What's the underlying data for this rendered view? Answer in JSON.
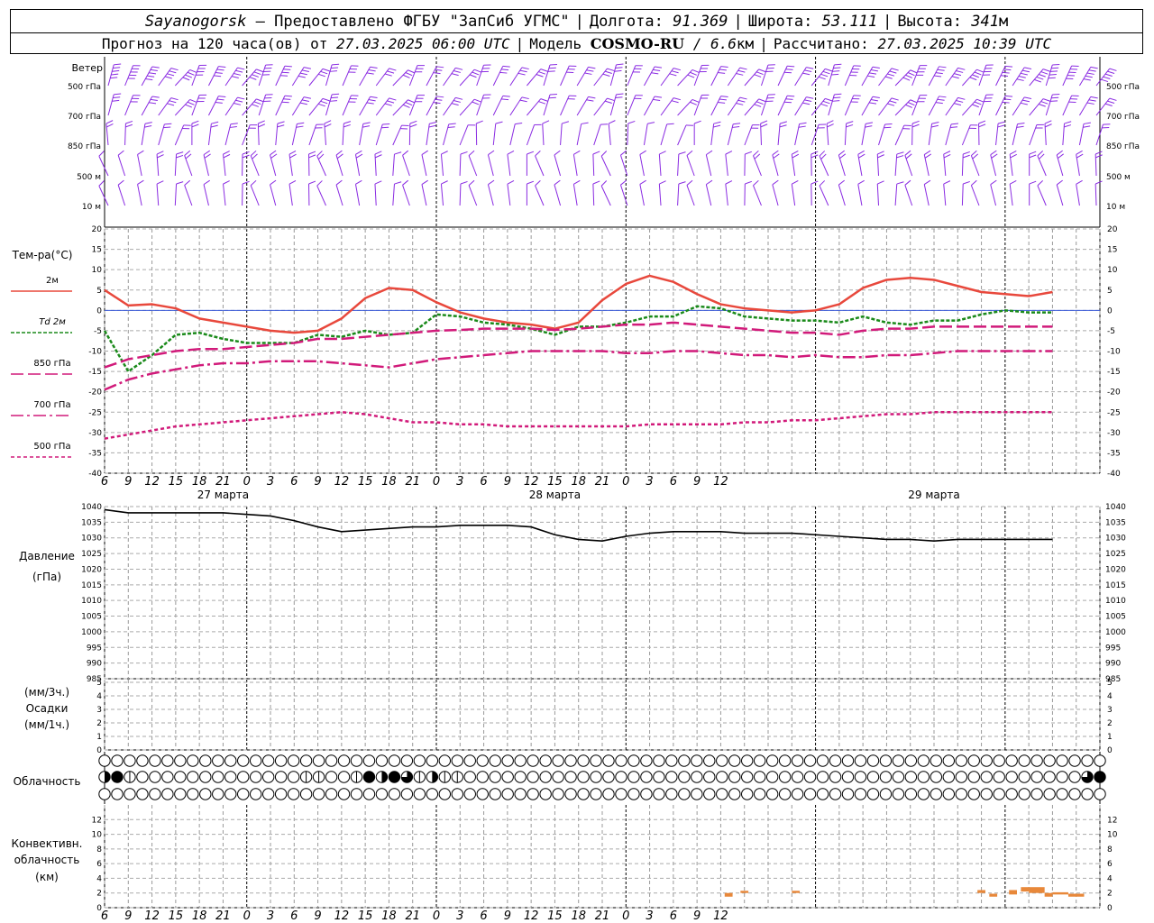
{
  "header": {
    "city": "Sayanogorsk",
    "dash": "—",
    "provider": "Предоставлено ФГБУ \"ЗапСиб УГМС\"",
    "lon_label": "Долгота:",
    "lon_value": "91.369",
    "lat_label": "Широта:",
    "lat_value": "53.111",
    "alt_label": "Высота:",
    "alt_value": "341",
    "alt_unit": "м",
    "forecast_label": "Прогноз на 120 часа(ов) от",
    "forecast_start": "27.03.2025 06:00 UTC",
    "model_label": "Модель",
    "model_name": "COSMO-RU",
    "model_res": "6.6",
    "model_res_unit": "км",
    "calc_label": "Рассчитано:",
    "calc_time": "27.03.2025 10:39 UTC"
  },
  "colors": {
    "t2m": "#e8483c",
    "td": "#1a8a1a",
    "t850": "#d11a7a",
    "t700": "#d11a7a",
    "t500": "#d11a7a",
    "wind": "#8a2be2",
    "pressure": "#000000",
    "convective": "#e8883a",
    "zero_line": "#3a5ad8"
  },
  "wind_panel": {
    "title": "Ветер",
    "levels": [
      "500 гПа",
      "700 гПа",
      "850 гПа",
      "500 м",
      "10  м"
    ]
  },
  "temp_panel": {
    "title": "Тем-ра(°С)",
    "legend": [
      {
        "label": "2м",
        "key": "t2m"
      },
      {
        "label_prefix": "Td",
        "label": "2м",
        "key": "td"
      },
      {
        "label": "850 гПа",
        "key": "t850"
      },
      {
        "label": "700 гПа",
        "key": "t700"
      },
      {
        "label": "500 гПа",
        "key": "t500"
      }
    ]
  },
  "pressure_panel": {
    "label_1": "Давление",
    "label_2": "(гПа)"
  },
  "precip_panel": {
    "label_1": "(мм/3ч.)",
    "label_2": "Осадки",
    "label_3": "(мм/1ч.)"
  },
  "cloud_panel": {
    "label": "Облачность"
  },
  "conv_panel": {
    "label_1": "Конвективн.",
    "label_2": "облачность",
    "label_3": "(км)"
  },
  "chart_data": [
    {
      "type": "line",
      "name": "temperature",
      "x_hours": [
        0,
        3,
        6,
        9,
        12,
        15,
        18,
        21,
        24,
        27,
        30,
        33,
        36,
        39,
        42,
        45,
        48,
        51,
        54,
        57,
        60,
        63,
        66,
        69,
        72,
        75,
        78,
        81,
        84,
        87,
        90,
        93,
        96,
        99,
        102,
        105,
        108,
        111,
        114,
        117,
        120
      ],
      "x_tick_labels": [
        "6",
        "9",
        "12",
        "15",
        "18",
        "21",
        "0",
        "3",
        "6",
        "9",
        "12",
        "15",
        "18",
        "21",
        "0",
        "3",
        "6",
        "9",
        "12",
        "15",
        "18",
        "21",
        "0",
        "3",
        "6",
        "9",
        "12"
      ],
      "x_day_labels": [
        "27 марта",
        "28 марта",
        "29 марта"
      ],
      "ylim": [
        -40,
        20
      ],
      "yticks": [
        20,
        15,
        10,
        5,
        0,
        -5,
        -10,
        -15,
        -20,
        -25,
        -30,
        -35,
        -40
      ],
      "series": [
        {
          "key": "t2m",
          "values": [
            5,
            1.2,
            1.5,
            0.5,
            -2,
            -3,
            -4,
            -5,
            -5.5,
            -5,
            -2,
            3,
            5.5,
            5,
            2,
            -0.5,
            -2,
            -3,
            -3.5,
            -4.5,
            -3,
            2.5,
            6.5,
            8.5,
            7,
            4,
            1.5,
            0.5,
            0,
            -0.5,
            0,
            1.5,
            5.5,
            7.5,
            8,
            7.5,
            6,
            4.5,
            4,
            3.5,
            4.5
          ]
        },
        {
          "key": "td",
          "values": [
            -5,
            -15,
            -11,
            -6,
            -5.5,
            -7,
            -8,
            -8,
            -8,
            -6,
            -6.5,
            -5,
            -6,
            -5.5,
            -1,
            -1.5,
            -3,
            -3.5,
            -4.5,
            -6,
            -4,
            -4,
            -3,
            -1.5,
            -1.5,
            1,
            0.5,
            -1.5,
            -2,
            -2.5,
            -2.5,
            -3,
            -1.5,
            -3,
            -3.5,
            -2.5,
            -2.5,
            -1,
            0,
            -0.5,
            -0.5
          ]
        },
        {
          "key": "t850",
          "values": [
            -14,
            -12,
            -11,
            -10,
            -9.5,
            -9.5,
            -9,
            -8.5,
            -8,
            -7,
            -7,
            -6.5,
            -6,
            -5.5,
            -5,
            -4.8,
            -4.5,
            -4.5,
            -4.5,
            -4.8,
            -4.5,
            -4,
            -3.5,
            -3.5,
            -3,
            -3.5,
            -4,
            -4.5,
            -5,
            -5.5,
            -5.5,
            -6,
            -5,
            -4.5,
            -4.5,
            -4,
            -4,
            -4,
            -4,
            -4,
            -4
          ]
        },
        {
          "key": "t700",
          "values": [
            -19.5,
            -17,
            -15.5,
            -14.5,
            -13.5,
            -13,
            -13,
            -12.5,
            -12.5,
            -12.5,
            -13,
            -13.5,
            -14,
            -13,
            -12,
            -11.5,
            -11,
            -10.5,
            -10,
            -10,
            -10,
            -10,
            -10.5,
            -10.5,
            -10,
            -10,
            -10.5,
            -11,
            -11,
            -11.5,
            -11,
            -11.5,
            -11.5,
            -11,
            -11,
            -10.5,
            -10,
            -10,
            -10,
            -10,
            -10
          ]
        },
        {
          "key": "t500",
          "values": [
            -31.5,
            -30.5,
            -29.5,
            -28.5,
            -28,
            -27.5,
            -27,
            -26.5,
            -26,
            -25.5,
            -25,
            -25.5,
            -26.5,
            -27.5,
            -27.5,
            -28,
            -28,
            -28.5,
            -28.5,
            -28.5,
            -28.5,
            -28.5,
            -28.5,
            -28,
            -28,
            -28,
            -28,
            -27.5,
            -27.5,
            -27,
            -27,
            -26.5,
            -26,
            -25.5,
            -25.5,
            -25,
            -25,
            -25,
            -25,
            -25,
            -25
          ]
        }
      ]
    },
    {
      "type": "line",
      "name": "pressure",
      "ylim": [
        985,
        1040
      ],
      "yticks": [
        1040,
        1035,
        1030,
        1025,
        1020,
        1015,
        1010,
        1005,
        1000,
        995,
        990,
        985
      ],
      "x_hours": [
        0,
        3,
        6,
        9,
        12,
        15,
        18,
        21,
        24,
        27,
        30,
        33,
        36,
        39,
        42,
        45,
        48,
        51,
        54,
        57,
        60,
        63,
        66,
        69,
        72,
        75,
        78,
        81,
        84,
        87,
        90,
        93,
        96,
        99,
        102,
        105,
        108,
        111,
        114,
        117,
        120
      ],
      "values": [
        1039,
        1038,
        1038,
        1038,
        1038,
        1038,
        1037.5,
        1037,
        1035.5,
        1033.5,
        1032,
        1032.5,
        1033,
        1033.5,
        1033.5,
        1034,
        1034,
        1034,
        1033.5,
        1031,
        1029.5,
        1029,
        1030.5,
        1031.5,
        1032,
        1032,
        1032,
        1031.5,
        1031.5,
        1031.5,
        1031,
        1030.5,
        1030,
        1029.5,
        1029.5,
        1029,
        1029.5,
        1029.5,
        1029.5,
        1029.5,
        1029.5
      ]
    },
    {
      "type": "bar",
      "name": "precipitation",
      "ylim": [
        0,
        5
      ],
      "yticks": [
        5,
        4,
        3,
        2,
        1,
        0
      ],
      "values": []
    },
    {
      "type": "bar",
      "name": "convective_cloud",
      "ylim": [
        0,
        14
      ],
      "yticks": [
        12,
        10,
        8,
        6,
        4,
        2,
        0
      ],
      "segments": [
        {
          "x0": 78.5,
          "x1": 79.5,
          "y0": 1.5,
          "y1": 2
        },
        {
          "x0": 80.5,
          "x1": 81.5,
          "y0": 2,
          "y1": 2.3
        },
        {
          "x0": 87,
          "x1": 88,
          "y0": 2,
          "y1": 2.3
        },
        {
          "x0": 110.5,
          "x1": 111.5,
          "y0": 2,
          "y1": 2.4
        },
        {
          "x0": 112,
          "x1": 113,
          "y0": 1.5,
          "y1": 1.9
        },
        {
          "x0": 114.5,
          "x1": 115.5,
          "y0": 1.8,
          "y1": 2.4
        },
        {
          "x0": 116,
          "x1": 117,
          "y0": 2.2,
          "y1": 2.8
        },
        {
          "x0": 117,
          "x1": 119,
          "y0": 2,
          "y1": 2.8
        },
        {
          "x0": 119,
          "x1": 120,
          "y0": 1.5,
          "y1": 2
        },
        {
          "x0": 120,
          "x1": 122,
          "y0": 1.8,
          "y1": 2.1
        },
        {
          "x0": 122,
          "x1": 124,
          "y0": 1.5,
          "y1": 1.9
        }
      ]
    }
  ],
  "cloud_rows": [
    [
      0,
      0,
      0,
      0,
      0,
      0,
      0,
      0,
      0,
      0,
      0,
      0,
      0,
      0,
      0,
      0,
      0,
      0,
      0,
      0,
      0,
      0,
      0,
      0,
      0,
      0,
      0,
      0,
      0,
      0,
      0,
      0,
      0,
      0,
      0,
      0,
      0,
      0,
      0,
      0,
      0,
      0,
      0,
      0,
      0,
      0,
      0,
      0,
      0,
      0,
      0,
      0,
      0,
      0,
      0,
      0,
      0,
      0,
      0,
      0,
      0,
      0,
      0,
      0,
      0,
      0,
      0,
      0,
      0,
      0,
      0,
      0,
      0,
      0,
      0,
      0,
      0,
      0,
      0,
      0
    ],
    [
      2,
      4,
      1,
      0,
      0,
      0,
      0,
      0,
      0,
      0,
      0,
      0,
      0,
      0,
      0,
      0,
      1,
      1,
      0,
      0,
      1,
      4,
      2,
      4,
      3,
      1,
      2,
      1,
      1,
      0,
      0,
      0,
      0,
      0,
      0,
      0,
      0,
      0,
      0,
      0,
      0,
      0,
      0,
      0,
      0,
      0,
      0,
      0,
      0,
      0,
      0,
      0,
      0,
      0,
      0,
      0,
      0,
      0,
      0,
      0,
      0,
      0,
      0,
      0,
      0,
      0,
      0,
      0,
      0,
      0,
      0,
      0,
      0,
      0,
      0,
      0,
      0,
      0,
      3,
      4
    ],
    [
      0,
      0,
      0,
      0,
      0,
      0,
      0,
      0,
      0,
      0,
      0,
      0,
      0,
      0,
      0,
      0,
      0,
      0,
      0,
      0,
      0,
      0,
      0,
      0,
      0,
      0,
      0,
      0,
      0,
      0,
      0,
      0,
      0,
      0,
      0,
      0,
      0,
      0,
      0,
      0,
      0,
      0,
      0,
      0,
      0,
      0,
      0,
      0,
      0,
      0,
      0,
      0,
      0,
      0,
      0,
      0,
      0,
      0,
      0,
      0,
      0,
      0,
      0,
      0,
      0,
      0,
      0,
      0,
      0,
      0,
      0,
      0,
      0,
      0,
      0,
      0,
      0,
      0,
      0,
      0
    ]
  ]
}
